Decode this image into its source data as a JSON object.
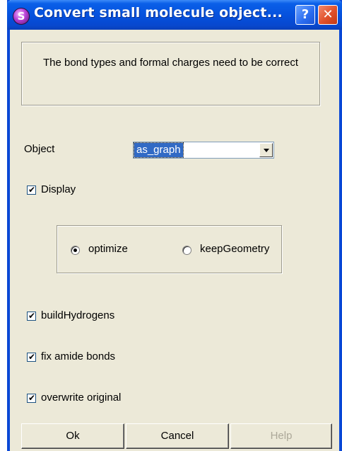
{
  "window": {
    "title": "Convert small molecule object...",
    "help_button": "?",
    "close_button": "✕"
  },
  "info": {
    "message": "The bond types and formal charges need to be correct"
  },
  "object": {
    "label": "Object",
    "value": "as_graph"
  },
  "display": {
    "label": "Display",
    "checked": true
  },
  "mode": {
    "options": [
      {
        "label": "optimize",
        "selected": true
      },
      {
        "label": "keepGeometry",
        "selected": false
      }
    ]
  },
  "options": {
    "build_hydrogens": {
      "label": "buildHydrogens",
      "checked": true
    },
    "fix_amide": {
      "label": "fix amide bonds",
      "checked": true
    },
    "overwrite": {
      "label": "overwrite original",
      "checked": true
    }
  },
  "buttons": {
    "ok": "Ok",
    "cancel": "Cancel",
    "help": "Help"
  },
  "check_glyph": "✔"
}
